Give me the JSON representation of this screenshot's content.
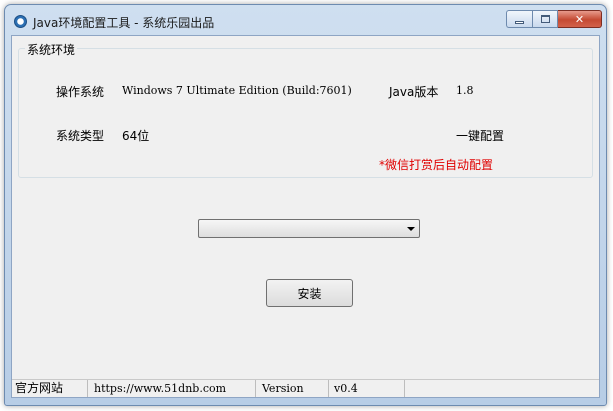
{
  "window": {
    "title": "Java环境配置工具 - 系统乐园出品"
  },
  "groupbox": {
    "legend": "系统环境",
    "os_label": "操作系统",
    "os_value": "Windows 7 Ultimate Edition (Build:7601)",
    "java_label": "Java版本",
    "java_value": "1.8",
    "type_label": "系统类型",
    "type_value": "64位",
    "one_click_label": "一键配置",
    "wechat_note": "*微信打赏后自动配置"
  },
  "combo": {
    "selected": ""
  },
  "install_button": {
    "label": "安装"
  },
  "statusbar": {
    "site_label": "官方网站",
    "site_url": "https://www.51dnb.com",
    "version_label": "Version",
    "version_value": "v0.4"
  },
  "colors": {
    "note_red": "#e00000",
    "titlebar_top": "#cfdff0",
    "client_bg": "#f0f0f0"
  },
  "icons": {
    "app": "app-globe-icon",
    "minimize": "minimize-icon",
    "maximize": "maximize-icon",
    "close": "close-icon",
    "combo": "chevron-down-icon"
  }
}
